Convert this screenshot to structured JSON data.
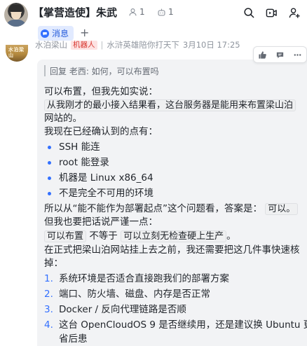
{
  "header": {
    "title": "【掌营造使】朱武",
    "member_count": "1",
    "bot_count": "1"
  },
  "tabs": {
    "messages_label": "消息",
    "add_label": "+"
  },
  "message": {
    "sender_name": "水泊梁山",
    "bot_badge": "机器人",
    "signature": "水浒英雄陪你打天下",
    "timestamp": "3月10日 17:25",
    "avatar_text": "水泊梁山",
    "reply_quote": "回复 老西: 如何，可以布置吗",
    "line1": "可以布置，但我先如实说：",
    "code1": "从我刚才的最小接入结果看，这台服务器是能用来布置梁山泊",
    "line2": "网站的。",
    "line3": "我现在已经确认到的点有：",
    "bullets": [
      "SSH 能连",
      "root 能登录",
      "机器是 Linux x86_64",
      "不是完全不可用的环境"
    ],
    "line4_pre": "所以从“能不能作为部署起点”这个问题看，答案是：",
    "line4_code": "可以。",
    "line5": "但我也要把话说严谨一点：",
    "line6_code1": "可以布置",
    "line6_mid": "不等于",
    "line6_code2": "可以立刻无检查硬上生产",
    "line6_end": "。",
    "line7": "在正式把梁山泊网站挂上去之前，我还需要把这几件事快速核",
    "line8": "掉：",
    "numbered": [
      {
        "num": "1.",
        "text": "系统环境是否适合直接跑我们的部署方案"
      },
      {
        "num": "2.",
        "text": "端口、防火墙、磁盘、内存是否正常"
      },
      {
        "num": "3.",
        "text": "Docker / 反向代理链路是否顺"
      },
      {
        "num": "4.",
        "text": "这台 OpenCloudOS 9 是否继续用，还是建议换 Ubuntu 更"
      }
    ],
    "line9": "省后患"
  },
  "colors": {
    "accent": "#3370ff",
    "bubble_bg": "#f2f3f5",
    "tab_bg": "#e1eaff",
    "badge_bg": "#fde2e2",
    "badge_text": "#d83931"
  },
  "icons": {
    "search": "search-icon",
    "video": "video-icon",
    "add_member": "add-member-icon",
    "member": "member-icon",
    "bot": "bot-icon",
    "thumbs_up": "thumbs-up-icon",
    "reply": "reply-icon",
    "more": "more-icon"
  }
}
